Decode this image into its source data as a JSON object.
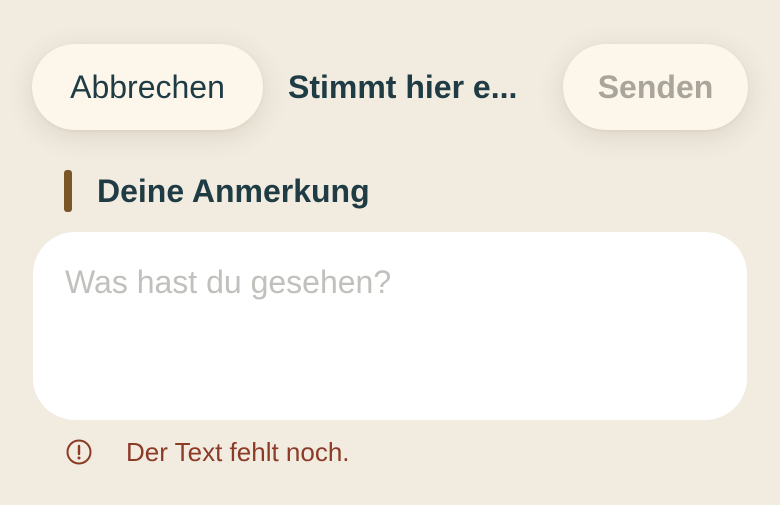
{
  "toolbar": {
    "cancel_label": "Abbrechen",
    "title": "Stimmt hier e...",
    "send_label": "Senden"
  },
  "section": {
    "title": "Deine Anmerkung"
  },
  "input": {
    "value": "",
    "placeholder": "Was hast du gesehen?"
  },
  "error": {
    "icon": "exclamation-circle-icon",
    "message": "Der Text fehlt noch."
  },
  "colors": {
    "background": "#f1ebe0",
    "pill": "#fdf7eb",
    "text_primary": "#1f3b44",
    "send_disabled": "#aaa59b",
    "accent_bar": "#7b5627",
    "error": "#8c3b27"
  }
}
